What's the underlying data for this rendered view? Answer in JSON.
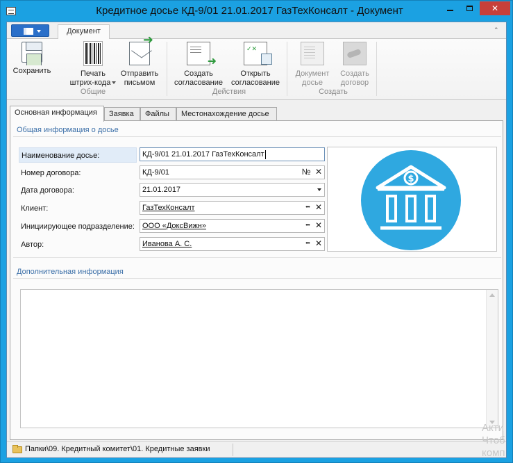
{
  "window": {
    "title": "Кредитное досье КД-9/01 21.01.2017 ГазТехКонсалт - Документ",
    "minimize_label": "—",
    "close_label": "✕"
  },
  "ribbon": {
    "tab_document": "Документ",
    "groups": {
      "general": "Общие",
      "actions": "Действия",
      "create": "Создать"
    },
    "buttons": {
      "save": "Сохранить",
      "print_barcode_1": "Печать",
      "print_barcode_2": "штрих-кода",
      "send_email_1": "Отправить",
      "send_email_2": "письмом",
      "create_approval_1": "Создать",
      "create_approval_2": "согласование",
      "open_approval_1": "Открыть",
      "open_approval_2": "согласование",
      "dossier_doc_1": "Документ",
      "dossier_doc_2": "досье",
      "create_contract_1": "Создать",
      "create_contract_2": "договор"
    }
  },
  "tabs": [
    "Основная информация",
    "Заявка",
    "Файлы",
    "Местонахождение досье"
  ],
  "general_info": {
    "title": "Общая информация о досье",
    "fields": {
      "dossier_name": {
        "label": "Наименование досье:",
        "value": "КД-9/01 21.01.2017 ГазТехКонсалт"
      },
      "contract_number": {
        "label": "Номер договора:",
        "value": "КД-9/01",
        "btn": "№"
      },
      "contract_date": {
        "label": "Дата договора:",
        "value": "21.01.2017"
      },
      "client": {
        "label": "Клиент:",
        "value": "ГазТехКонсалт"
      },
      "department": {
        "label": "Инициирующее подразделение:",
        "value": "ООО «ДоксВижн»"
      },
      "author": {
        "label": "Автор:",
        "value": "Иванова А. С."
      }
    },
    "ellipsis": "•••",
    "clear": "✕"
  },
  "additional_info": {
    "title": "Дополнительная информация",
    "text": ""
  },
  "statusbar": {
    "path": "Папки\\09. Кредитный комитет\\01. Кредитные заявки"
  },
  "watermark": {
    "line1": "Акти",
    "line2": "Чтоб",
    "line3": "комп"
  },
  "colors": {
    "accent": "#1ba1e2",
    "bank_icon": "#2fa8e0",
    "section_title": "#3b6fa8"
  }
}
